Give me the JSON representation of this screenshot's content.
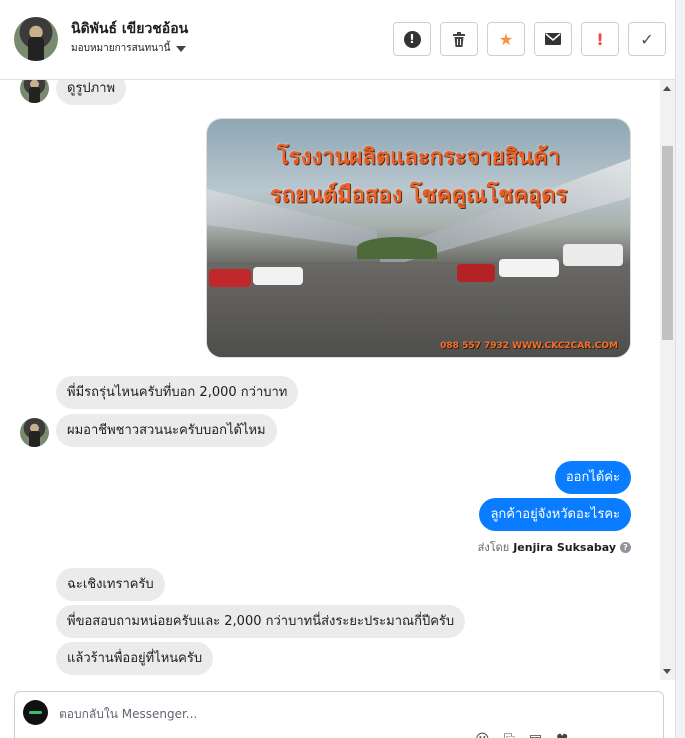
{
  "header": {
    "contact_name": "นิดิพันธ์ เขียวชอ้อน",
    "assign_label": "มอบหมายการสนทนานี้",
    "actions": [
      {
        "name": "report-spam-button",
        "icon": "circle-exclamation-icon",
        "glyph": "!"
      },
      {
        "name": "delete-button",
        "icon": "trash-icon",
        "glyph": "🗑"
      },
      {
        "name": "star-button",
        "icon": "star-icon",
        "glyph": "★"
      },
      {
        "name": "mark-unread-button",
        "icon": "envelope-icon",
        "glyph": "✉"
      },
      {
        "name": "follow-up-button",
        "icon": "exclamation-icon",
        "glyph": "!"
      },
      {
        "name": "mark-done-button",
        "icon": "checkmark-icon",
        "glyph": "✓"
      }
    ]
  },
  "messages": {
    "in_1": "ดูรูปภาพ",
    "image": {
      "title_line1": "โรงงานผลิตและกระจายสินค้า",
      "title_line2": "รถยนต์มือสอง โชคคูณโชคอุดร",
      "footer": "088 557 7932 WWW.CKC2CAR.COM"
    },
    "in_2": "พี่มีรถรุ่นไหนครับที่บอก 2,000 กว่าบาท",
    "in_3": "ผมอาชีพชาวสวนนะครับบอกได้ไหม",
    "out_1": "ออกได้ค่ะ",
    "out_2": "ลูกค้าอยู่จังหวัดอะไรคะ",
    "sent_by_prefix": "ส่งโดย",
    "sent_by_name": "Jenjira Suksabay",
    "in_4": "ฉะเชิงเทราครับ",
    "in_5": "พี่ขอสอบถามหน่อยครับและ 2,000 กว่าบาทนี่ส่งระยะประมาณกี่ปีครับ",
    "in_6": "แล้วร้านพื่ออยู่ที่ไหนครับ"
  },
  "composer": {
    "placeholder": "ตอบกลับใน Messenger..."
  },
  "colors": {
    "accent": "#0a7cff",
    "incoming_bubble": "#ebebeb",
    "star": "#f7923b",
    "alert": "#fa3e3e"
  }
}
